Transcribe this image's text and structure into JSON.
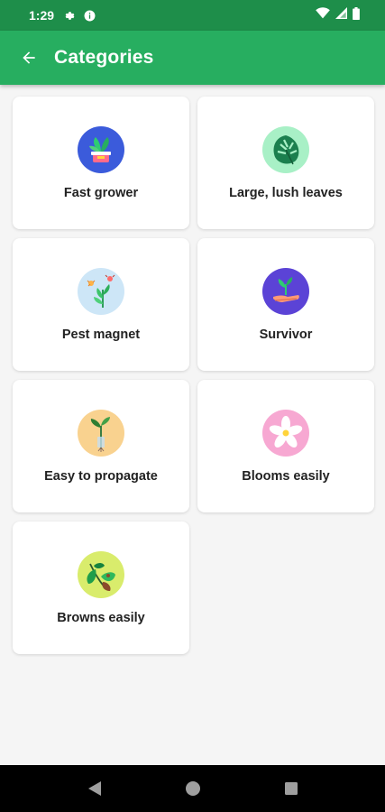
{
  "status_bar": {
    "time": "1:29"
  },
  "app_bar": {
    "title": "Categories"
  },
  "categories": [
    {
      "label": "Fast grower",
      "icon": "potted-plant-icon",
      "bg": "#3b5bdb"
    },
    {
      "label": "Large, lush leaves",
      "icon": "monstera-leaf-icon",
      "bg": "#a8f0c6"
    },
    {
      "label": "Pest magnet",
      "icon": "bug-plant-icon",
      "bg": "#cde6f7"
    },
    {
      "label": "Survivor",
      "icon": "hand-sprout-icon",
      "bg": "#5b43d6"
    },
    {
      "label": "Easy to propagate",
      "icon": "cutting-sprout-icon",
      "bg": "#f9d28f"
    },
    {
      "label": "Blooms easily",
      "icon": "flower-icon",
      "bg": "#f7a8d2"
    },
    {
      "label": "Browns easily",
      "icon": "brown-leaves-icon",
      "bg": "#d9ec6c"
    }
  ],
  "colors": {
    "status_bar": "#1e8e4a",
    "app_bar": "#27ae60",
    "background": "#f5f5f5"
  }
}
